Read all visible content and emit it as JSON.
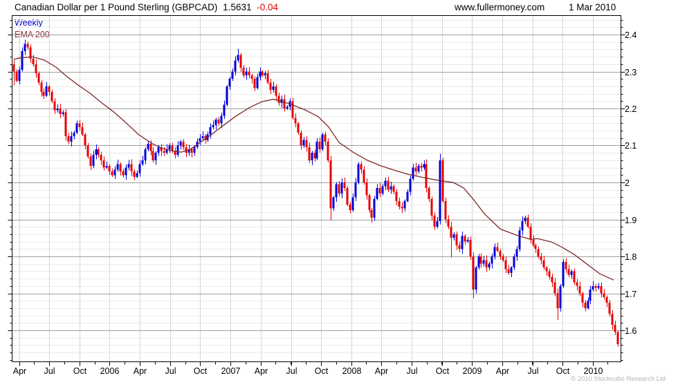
{
  "header": {
    "title": "Canadian Dollar per 1 Pound Sterling (GBPCAD)",
    "last": "1.5631",
    "change": "-0.04",
    "site": "www.fullermoney.com",
    "date": "1 Mar 2010"
  },
  "legend": {
    "timeframe": "Weekly",
    "overlay": "EMA 200"
  },
  "footer": {
    "copyright": "© 2010 Stockcube Research Ltd"
  },
  "colors": {
    "up": "#0000dd",
    "down": "#e80000",
    "ema_line": "#7d2727",
    "weekly_label": "#0000cc",
    "ema_label": "#943434",
    "grid_minor": "#eaeaea",
    "grid_major": "#9e9e9e",
    "grid_vert": "#d4d4d4",
    "frame": "#000000",
    "copyright_text": "#b3b3b3",
    "change_text": "#dd0000"
  },
  "chart_data": {
    "type": "candlestick",
    "title": "Canadian Dollar per 1 Pound Sterling (GBPCAD)",
    "timeframe": "Weekly",
    "overlay": "EMA 200",
    "last_price": 1.5631,
    "change": -0.04,
    "as_of": "1 Mar 2010",
    "y_axis": {
      "tick_labels": [
        "2.4",
        "2.3",
        "2.2",
        "2.1",
        "2",
        "1.9",
        "1.8",
        "1.7",
        "1.6"
      ],
      "tick_values": [
        2.4,
        2.3,
        2.2,
        2.1,
        2.0,
        1.9,
        1.8,
        1.7,
        1.6
      ],
      "minor_step": 0.02,
      "range_shown": [
        1.516,
        2.452
      ],
      "side": "right",
      "grid": true
    },
    "x_axis": {
      "labels": [
        "Apr",
        "Jul",
        "Oct",
        "2006",
        "Apr",
        "Jul",
        "Oct",
        "2007",
        "Apr",
        "Jul",
        "Oct",
        "2008",
        "Apr",
        "Jul",
        "Oct",
        "2009",
        "Apr",
        "Jul",
        "Oct",
        "2010"
      ],
      "label_week_positions": [
        1.9,
        12.9,
        24.0,
        35.0,
        46.1,
        57.2,
        68.2,
        79.3,
        90.3,
        101.4,
        112.4,
        123.5,
        134.5,
        145.6,
        156.6,
        167.7,
        178.7,
        189.8,
        200.8,
        211.9
      ],
      "start": "Mar 2005",
      "end": "Mar 2010",
      "grid": true
    },
    "first_open": 2.32,
    "weekly_closes": [
      2.3,
      2.275,
      2.305,
      2.355,
      2.375,
      2.365,
      2.335,
      2.32,
      2.295,
      2.27,
      2.245,
      2.235,
      2.26,
      2.245,
      2.22,
      2.195,
      2.2,
      2.185,
      2.19,
      2.125,
      2.11,
      2.125,
      2.135,
      2.16,
      2.15,
      2.13,
      2.1,
      2.07,
      2.045,
      2.075,
      2.09,
      2.075,
      2.06,
      2.04,
      2.045,
      2.03,
      2.02,
      2.035,
      2.05,
      2.03,
      2.02,
      2.04,
      2.05,
      2.03,
      2.015,
      2.025,
      2.05,
      2.06,
      2.09,
      2.105,
      2.085,
      2.06,
      2.08,
      2.095,
      2.085,
      2.08,
      2.09,
      2.1,
      2.085,
      2.075,
      2.1,
      2.11,
      2.095,
      2.08,
      2.09,
      2.08,
      2.095,
      2.11,
      2.12,
      2.125,
      2.115,
      2.13,
      2.15,
      2.155,
      2.17,
      2.16,
      2.18,
      2.21,
      2.26,
      2.28,
      2.3,
      2.33,
      2.345,
      2.31,
      2.29,
      2.3,
      2.29,
      2.28,
      2.255,
      2.285,
      2.3,
      2.29,
      2.295,
      2.27,
      2.25,
      2.26,
      2.235,
      2.215,
      2.225,
      2.2,
      2.205,
      2.22,
      2.175,
      2.16,
      2.135,
      2.1,
      2.115,
      2.095,
      2.06,
      2.08,
      2.065,
      2.11,
      2.09,
      2.13,
      2.11,
      2.06,
      1.93,
      1.96,
      1.995,
      1.97,
      2.0,
      1.985,
      1.94,
      1.925,
      1.96,
      2.0,
      2.05,
      2.035,
      2.0,
      1.965,
      1.925,
      1.905,
      1.955,
      1.985,
      1.97,
      1.99,
      2.005,
      1.98,
      1.99,
      1.975,
      1.95,
      1.935,
      1.93,
      1.95,
      1.975,
      2.01,
      2.04,
      2.03,
      2.045,
      2.04,
      2.05,
      1.985,
      1.955,
      1.91,
      1.88,
      1.895,
      2.06,
      1.95,
      1.9,
      1.88,
      1.85,
      1.86,
      1.83,
      1.82,
      1.855,
      1.84,
      1.845,
      1.8,
      1.71,
      1.77,
      1.8,
      1.78,
      1.79,
      1.77,
      1.78,
      1.8,
      1.825,
      1.815,
      1.8,
      1.79,
      1.765,
      1.755,
      1.77,
      1.8,
      1.82,
      1.87,
      1.895,
      1.905,
      1.88,
      1.845,
      1.83,
      1.82,
      1.8,
      1.79,
      1.77,
      1.76,
      1.745,
      1.73,
      1.7,
      1.66,
      1.72,
      1.785,
      1.765,
      1.75,
      1.76,
      1.73,
      1.72,
      1.7,
      1.675,
      1.66,
      1.68,
      1.71,
      1.72,
      1.715,
      1.72,
      1.7,
      1.69,
      1.675,
      1.645,
      1.615,
      1.595,
      1.5631
    ],
    "wick_overrides": {
      "0": {
        "h": 2.332,
        "l": 2.263
      },
      "4": {
        "h": 2.386
      },
      "44": {
        "l": 2.007
      },
      "82": {
        "h": 2.362
      },
      "116": {
        "l": 1.897
      },
      "156": {
        "h": 2.078
      },
      "160": {
        "l": 1.797
      },
      "168": {
        "l": 1.687
      },
      "199": {
        "l": 1.628
      },
      "221": {
        "l": 1.556
      }
    },
    "ema200_anchors": [
      [
        0,
        2.333
      ],
      [
        2.5,
        2.337
      ],
      [
        6.6,
        2.34
      ],
      [
        11.1,
        2.331
      ],
      [
        15.4,
        2.312
      ],
      [
        19.5,
        2.286
      ],
      [
        23.8,
        2.262
      ],
      [
        28.1,
        2.24
      ],
      [
        32.2,
        2.215
      ],
      [
        36.5,
        2.191
      ],
      [
        40.5,
        2.165
      ],
      [
        45.6,
        2.13
      ],
      [
        50.6,
        2.105
      ],
      [
        54.4,
        2.092
      ],
      [
        58.2,
        2.085
      ],
      [
        61.3,
        2.082
      ],
      [
        64.6,
        2.09
      ],
      [
        70.9,
        2.122
      ],
      [
        75.9,
        2.15
      ],
      [
        81.0,
        2.178
      ],
      [
        86.1,
        2.202
      ],
      [
        90.6,
        2.218
      ],
      [
        94.9,
        2.225
      ],
      [
        101.3,
        2.212
      ],
      [
        106.3,
        2.197
      ],
      [
        111.4,
        2.178
      ],
      [
        115.2,
        2.15
      ],
      [
        119.0,
        2.108
      ],
      [
        124.1,
        2.082
      ],
      [
        129.1,
        2.061
      ],
      [
        134.2,
        2.045
      ],
      [
        139.2,
        2.033
      ],
      [
        144.3,
        2.022
      ],
      [
        149.4,
        2.014
      ],
      [
        155.7,
        2.005
      ],
      [
        160.8,
        2.0
      ],
      [
        164.6,
        1.985
      ],
      [
        168.4,
        1.952
      ],
      [
        172.2,
        1.915
      ],
      [
        178.0,
        1.874
      ],
      [
        184.1,
        1.857
      ],
      [
        189.1,
        1.846
      ],
      [
        191.6,
        1.848
      ],
      [
        196.7,
        1.839
      ],
      [
        200.8,
        1.824
      ],
      [
        205.1,
        1.805
      ],
      [
        209.4,
        1.781
      ],
      [
        214.4,
        1.753
      ],
      [
        219.5,
        1.736
      ]
    ],
    "legend_position": "top-left",
    "grid": "minor 0.02 / major 0.1 horizontal, quarterly vertical"
  }
}
